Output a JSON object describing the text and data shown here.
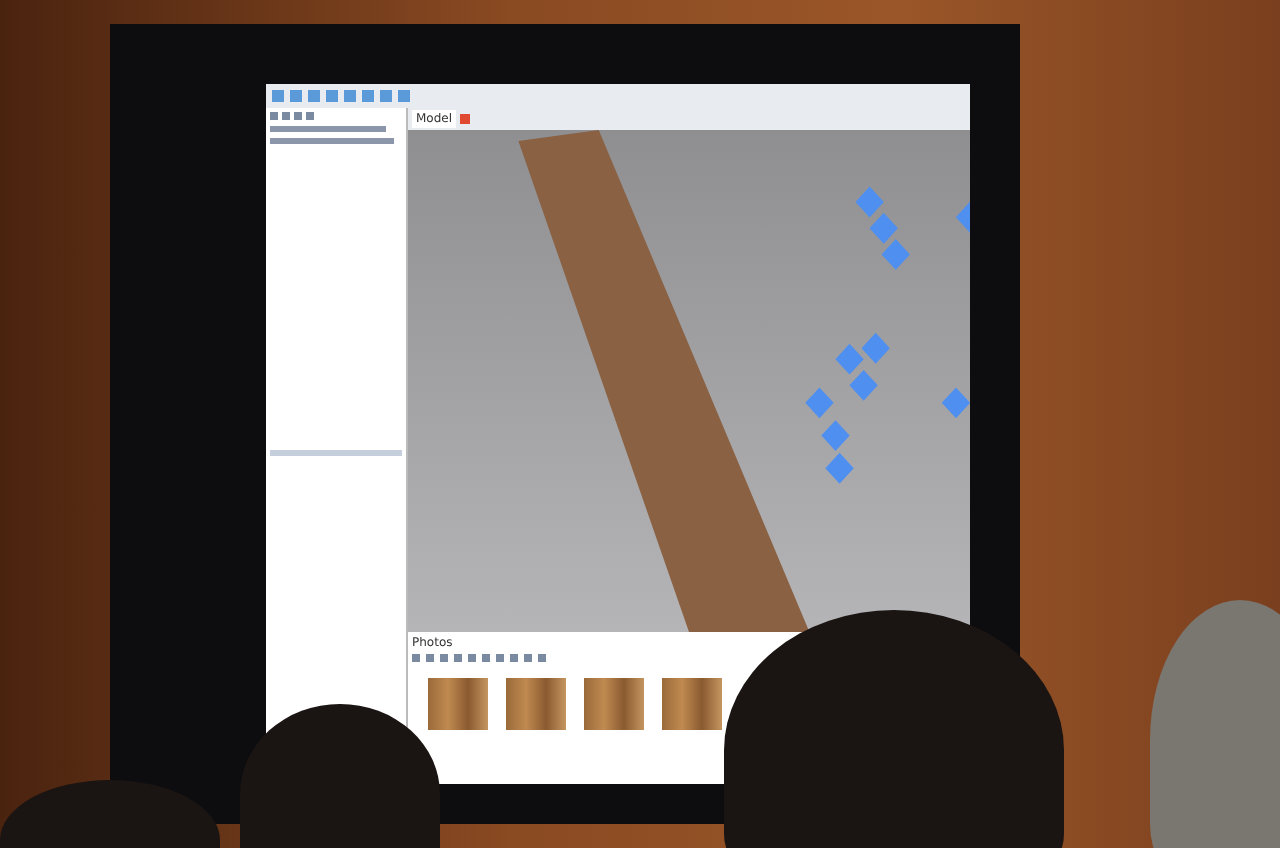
{
  "viewport": {
    "tab": "Model"
  },
  "photos_panel": {
    "title": "Photos"
  }
}
